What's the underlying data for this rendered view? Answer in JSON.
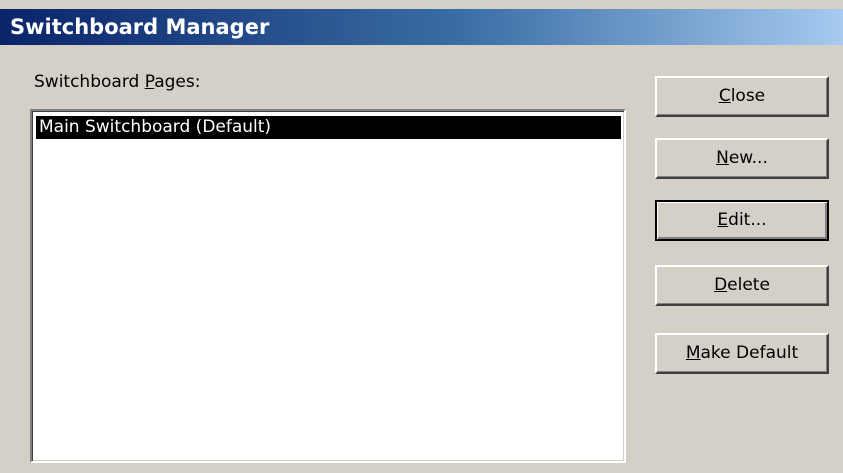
{
  "window": {
    "title": "Switchboard Manager"
  },
  "pages_label": {
    "text": "Switchboard ",
    "accel": "P",
    "rest": "ages:"
  },
  "pages_list": {
    "items": [
      {
        "label": "Main Switchboard (Default)",
        "selected": true
      }
    ]
  },
  "buttons": {
    "close": {
      "accel": "C",
      "rest": "lose"
    },
    "new": {
      "accel": "N",
      "rest": "ew..."
    },
    "edit": {
      "accel": "E",
      "rest": "dit..."
    },
    "delete": {
      "accel": "D",
      "rest": "elete"
    },
    "make_default": {
      "accel": "M",
      "rest": "ake Default"
    }
  },
  "colors": {
    "titlebar_start": "#0a246a",
    "titlebar_end": "#a6caf0",
    "dialog_bg": "#d4d0c8",
    "selection_bg": "#000000",
    "selection_text": "#ffffff"
  }
}
